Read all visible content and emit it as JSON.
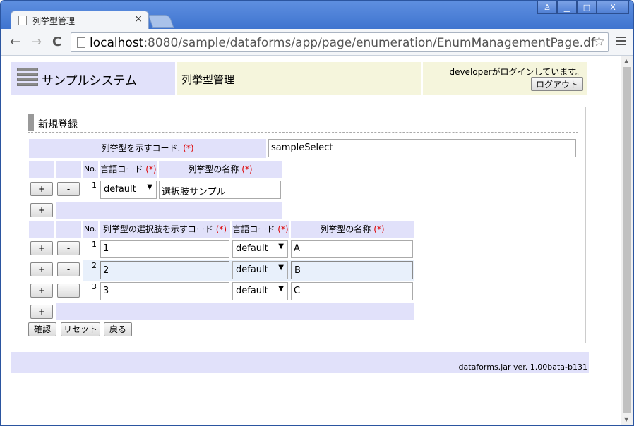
{
  "browser": {
    "tab_title": "列挙型管理",
    "tab_close": "×",
    "url_host": "localhost",
    "url_rest": ":8080/sample/dataforms/app/page/enumeration/EnumManagementPage.df",
    "back_icon": "←",
    "forward_icon": "→",
    "reload_icon": "C",
    "star_icon": "☆",
    "win_min": "▁",
    "win_max": "□",
    "win_close": "X",
    "win_user": "♙"
  },
  "header": {
    "system_name": "サンプルシステム",
    "page_title": "列挙型管理",
    "login_message": "developerがログインしています。",
    "logout_label": "ログアウト"
  },
  "section": {
    "title": "新規登録"
  },
  "enum_code": {
    "label": "列挙型を示すコード.",
    "required": "(*)",
    "value": "sampleSelect"
  },
  "name_table": {
    "col_no": "No.",
    "col_lang": "言語コード",
    "col_name": "列挙型の名称",
    "required": "(*)",
    "rows": [
      {
        "no": "1",
        "lang": "default",
        "name": "選択肢サンプル"
      }
    ]
  },
  "option_table": {
    "col_no": "No.",
    "col_code": "列挙型の選択肢を示すコード",
    "col_lang": "言語コード",
    "col_name": "列挙型の名称",
    "required": "(*)",
    "rows": [
      {
        "no": "1",
        "code": "1",
        "lang": "default",
        "name": "A"
      },
      {
        "no": "2",
        "code": "2",
        "lang": "default",
        "name": "B"
      },
      {
        "no": "3",
        "code": "3",
        "lang": "default",
        "name": "C"
      }
    ]
  },
  "buttons": {
    "add": "+",
    "remove": "-",
    "confirm": "確認",
    "reset": "リセット",
    "back": "戻る"
  },
  "footer": {
    "version": "dataforms.jar ver. 1.00bata-b131"
  }
}
